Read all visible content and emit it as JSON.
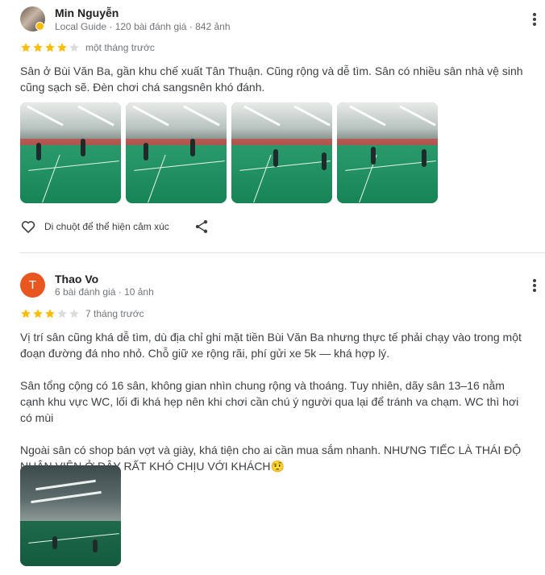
{
  "reviews": [
    {
      "author": "Min Nguyễn",
      "meta": "Local Guide · 120 bài đánh giá · 842 ảnh",
      "rating": 4,
      "max_rating": 5,
      "time": "một tháng trước",
      "text": [
        "Sân ở Bùi Văn Ba, gần khu chế xuất Tân Thuận. Cũng rộng và dễ tìm. Sân có nhiều sân nhà vệ sinh cũng sạch sẽ. Đèn chơi chá sangsnên khó đánh."
      ],
      "photo_count": 4,
      "react_label": "Di chuột để thể hiện cảm xúc"
    },
    {
      "author": "Thao Vo",
      "avatar_letter": "T",
      "meta": "6 bài đánh giá · 10 ảnh",
      "rating": 3,
      "max_rating": 5,
      "time": "7 tháng trước",
      "text": [
        "Vị trí sân cũng khá dễ tìm, dù địa chỉ ghi mặt tiền Bùi Văn Ba nhưng thực tế phải chạy vào trong một đoạn đường đá nho nhỏ. Chỗ giữ xe rộng rãi, phí gửi xe 5k — khá hợp lý.",
        "Sân tổng cộng có 16 sân, không gian nhìn chung rộng và thoáng. Tuy nhiên, dãy sân 13–16 nằm cạnh khu vực WC, lối đi khá hẹp nên khi chơi cần chú ý người qua lại để tránh va chạm. WC thì hơi có mùi",
        "Ngoài sân có shop bán vợt và giày, khá tiện cho ai cần mua sắm nhanh. NHƯNG TIẾC LÀ THÁI ĐỘ NHÂN VIÊN Ở ĐÂY RẤT KHÓ CHỊU VỚI KHÁCH🤨"
      ],
      "photo_count": 1
    }
  ],
  "colors": {
    "star_filled": "#fbbc04",
    "star_empty": "#dadce0",
    "avatar_letter_bg": "#e8571f"
  },
  "icons": {
    "more": "more-vert-icon",
    "heart": "heart-outline-icon",
    "share": "share-icon",
    "star": "star-icon"
  }
}
